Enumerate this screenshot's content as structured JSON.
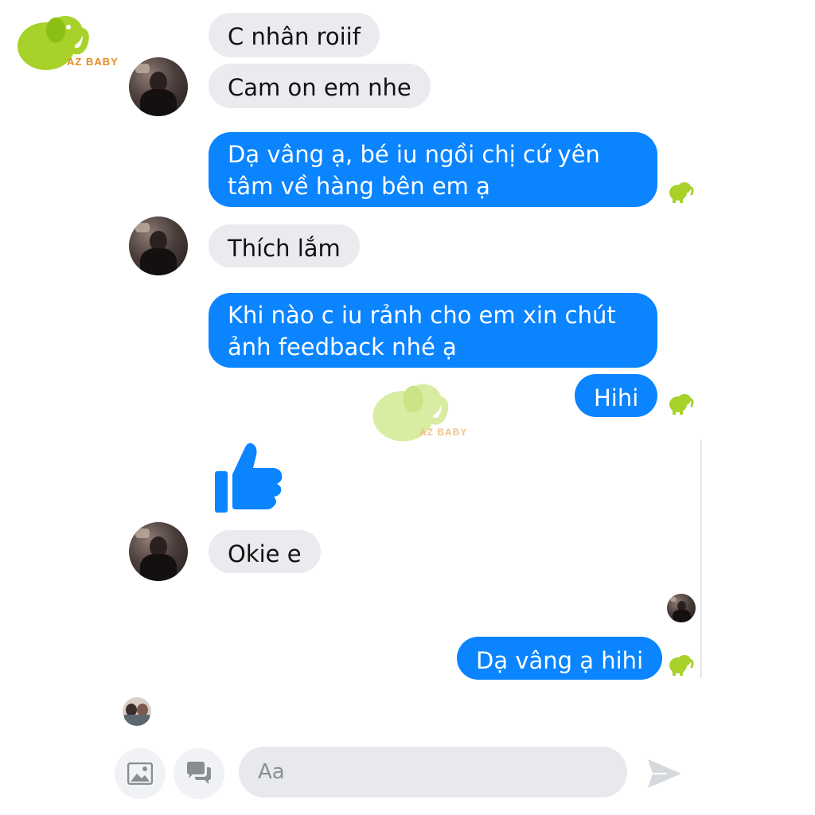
{
  "brand": {
    "logo_text": "AZ BABY",
    "watermark_text": "AZ BABY",
    "elephant_color": "#a6d22a"
  },
  "messages": [
    {
      "id": 1,
      "from": "them",
      "text": "C nhân roiif"
    },
    {
      "id": 2,
      "from": "them",
      "text": "Cam on em nhe"
    },
    {
      "id": 3,
      "from": "me",
      "lines": [
        "Dạ vâng ạ, bé iu ngồi chị cứ yên",
        "tâm về hàng bên em ạ"
      ]
    },
    {
      "id": 4,
      "from": "them",
      "text": "Thích lắm"
    },
    {
      "id": 5,
      "from": "me",
      "lines": [
        "Khi nào c iu rảnh cho em xin chút",
        "ảnh feedback nhé ạ"
      ]
    },
    {
      "id": 6,
      "from": "me",
      "text": "Hihi"
    },
    {
      "id": 7,
      "from": "them",
      "type": "like-sticker"
    },
    {
      "id": 8,
      "from": "them",
      "text": "Okie e"
    },
    {
      "id": 9,
      "from": "me",
      "text": "Dạ vâng ạ hihi"
    }
  ],
  "composer": {
    "placeholder": "Aa",
    "photo_icon": "photo-icon",
    "chat_icon": "chat-bubbles-icon",
    "send_icon": "send-icon"
  },
  "colors": {
    "outgoing": "#0a84ff",
    "incoming": "#e9ebee",
    "send_disabled": "#c7d7f0"
  }
}
